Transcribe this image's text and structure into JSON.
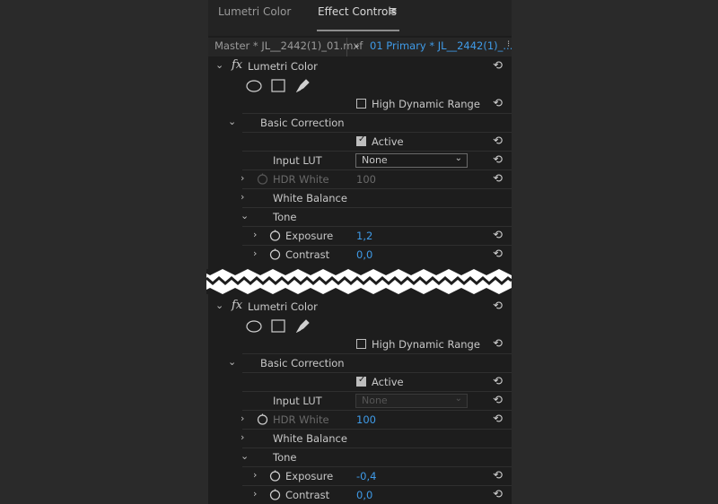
{
  "tabs": {
    "lumetri": "Lumetri Color",
    "effect_controls": "Effect Controls",
    "menu": "≡"
  },
  "clip": {
    "master": "Master * JL__2442(1)_01.mxf",
    "sequence": "01 Primary * JL__2442(1)_...",
    "chevron": "⌄"
  },
  "icons": {
    "reset": "⟲",
    "fx": "fx",
    "expanded": "⌄",
    "collapsed": "›"
  },
  "top": {
    "effect_name": "Lumetri Color",
    "hdr_label": "High Dynamic Range",
    "hdr_checked": false,
    "basic_correction": "Basic Correction",
    "active_label": "Active",
    "active_checked": true,
    "input_lut_label": "Input LUT",
    "input_lut_value": "None",
    "hdr_white_label": "HDR White",
    "hdr_white_value": "100",
    "white_balance": "White Balance",
    "tone": "Tone",
    "exposure_label": "Exposure",
    "exposure_value": "1,2",
    "contrast_label": "Contrast",
    "contrast_value": "0,0"
  },
  "bottom": {
    "effect_name": "Lumetri Color",
    "hdr_label": "High Dynamic Range",
    "hdr_checked": false,
    "basic_correction": "Basic Correction",
    "active_label": "Active",
    "active_checked": true,
    "input_lut_label": "Input LUT",
    "input_lut_value": "None",
    "hdr_white_label": "HDR White",
    "hdr_white_value": "100",
    "white_balance": "White Balance",
    "tone": "Tone",
    "exposure_label": "Exposure",
    "exposure_value": "-0,4",
    "contrast_label": "Contrast",
    "contrast_value": "0,0"
  }
}
